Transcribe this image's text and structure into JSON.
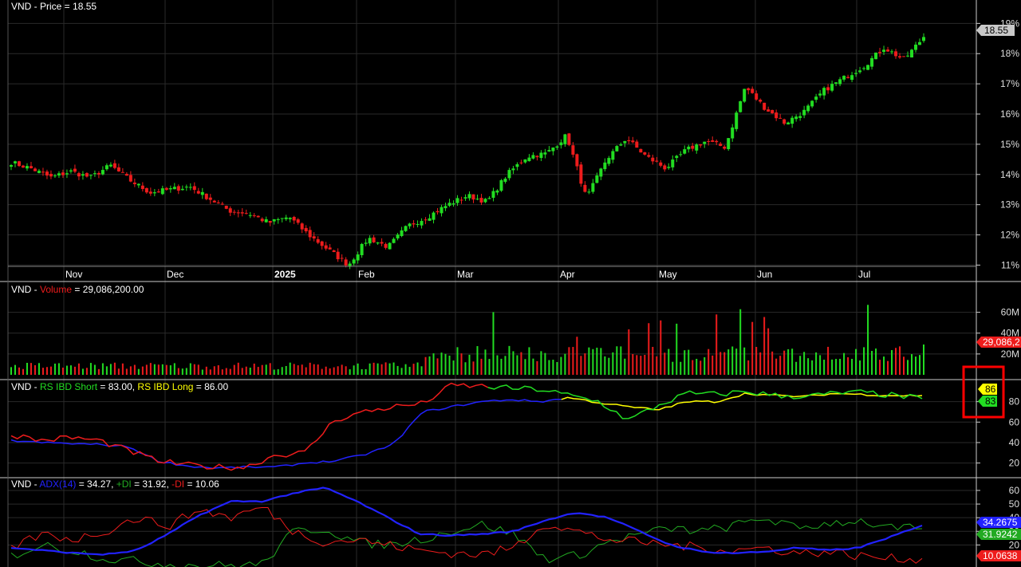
{
  "symbol": "VND",
  "colors": {
    "background": "#000000",
    "grid": "#2a2a2a",
    "up": "#22dd22",
    "down": "#ee1c1c",
    "text": "#ffffff",
    "axis": "#dddddd",
    "rs_short": "#22dd22",
    "rs_long": "#ffff00",
    "adx": "#2222ff",
    "plus_di": "#22aa22",
    "minus_di": "#ee1c1c",
    "highlight_box": "#ff0000"
  },
  "panels": {
    "price": {
      "prefix": "VND - ",
      "label": "Price = 18.55",
      "last_tag": "18.55"
    },
    "volume": {
      "prefix": "VND - ",
      "name": "Volume",
      "value": " = 29,086,200.00",
      "last_tag": "29,086,2"
    },
    "rs": {
      "prefix": "VND - ",
      "short_label": "RS IBD Short",
      "short_value": " = 83.00, ",
      "long_label": "RS IBD Long",
      "long_value": " = 86.00",
      "tag_long": "86",
      "tag_short": "83"
    },
    "adx": {
      "prefix": "VND - ",
      "adx_label": "ADX(14)",
      "adx_value": " = 34.27, ",
      "plus_label": "+DI",
      "plus_value": " = 31.92, ",
      "minus_label": "-DI",
      "minus_value": " = 10.06",
      "tag_adx": "34.2675",
      "tag_plus": "31.9242",
      "tag_minus": "10.0638"
    }
  },
  "x_axis_labels": [
    "Nov",
    "Dec",
    "2025",
    "Feb",
    "Mar",
    "Apr",
    "May",
    "Jun",
    "Jul"
  ],
  "chart_data": [
    {
      "type": "candlestick",
      "title": "VND - Price = 18.55",
      "y_ticks": [
        "11%",
        "12%",
        "13%",
        "14%",
        "15%",
        "16%",
        "17%",
        "18%",
        "19%"
      ],
      "ylim": [
        10.8,
        19.3
      ],
      "series": [
        {
          "name": "Price",
          "close_path": [
            14.4,
            14.2,
            13.9,
            14.1,
            13.9,
            14.3,
            13.8,
            13.4,
            13.5,
            13.6,
            13.2,
            12.8,
            12.7,
            12.4,
            12.6,
            12.0,
            11.5,
            11.0,
            11.9,
            11.6,
            12.3,
            12.6,
            13.0,
            13.3,
            13.1,
            14.0,
            14.6,
            14.7,
            15.3,
            13.2,
            14.5,
            15.2,
            14.6,
            14.2,
            14.8,
            15.1,
            14.9,
            16.9,
            16.2,
            15.7,
            16.1,
            16.8,
            17.2,
            17.6,
            18.2,
            17.8,
            18.55
          ]
        }
      ]
    },
    {
      "type": "bar",
      "title": "VND - Volume = 29,086,200.00",
      "y_ticks": [
        "20M",
        "40M",
        "60M"
      ],
      "ylim": [
        0,
        75
      ],
      "series": [
        {
          "name": "Volume",
          "last": 29.09
        }
      ]
    },
    {
      "type": "line",
      "title": "VND - RS IBD Short = 83.00, RS IBD Long = 86.00",
      "y_ticks": [
        "20",
        "40",
        "60",
        "80"
      ],
      "ylim": [
        8,
        100
      ],
      "series": [
        {
          "name": "RS IBD Short",
          "last": 83
        },
        {
          "name": "RS IBD Long",
          "last": 86
        }
      ]
    },
    {
      "type": "line",
      "title": "VND - ADX(14) = 34.27, +DI = 31.92, -DI = 10.06",
      "y_ticks": [
        "20",
        "30",
        "40",
        "50",
        "60"
      ],
      "ylim": [
        5,
        67
      ],
      "series": [
        {
          "name": "ADX(14)",
          "last": 34.27
        },
        {
          "name": "+DI",
          "last": 31.92
        },
        {
          "name": "-DI",
          "last": 10.06
        }
      ]
    }
  ]
}
